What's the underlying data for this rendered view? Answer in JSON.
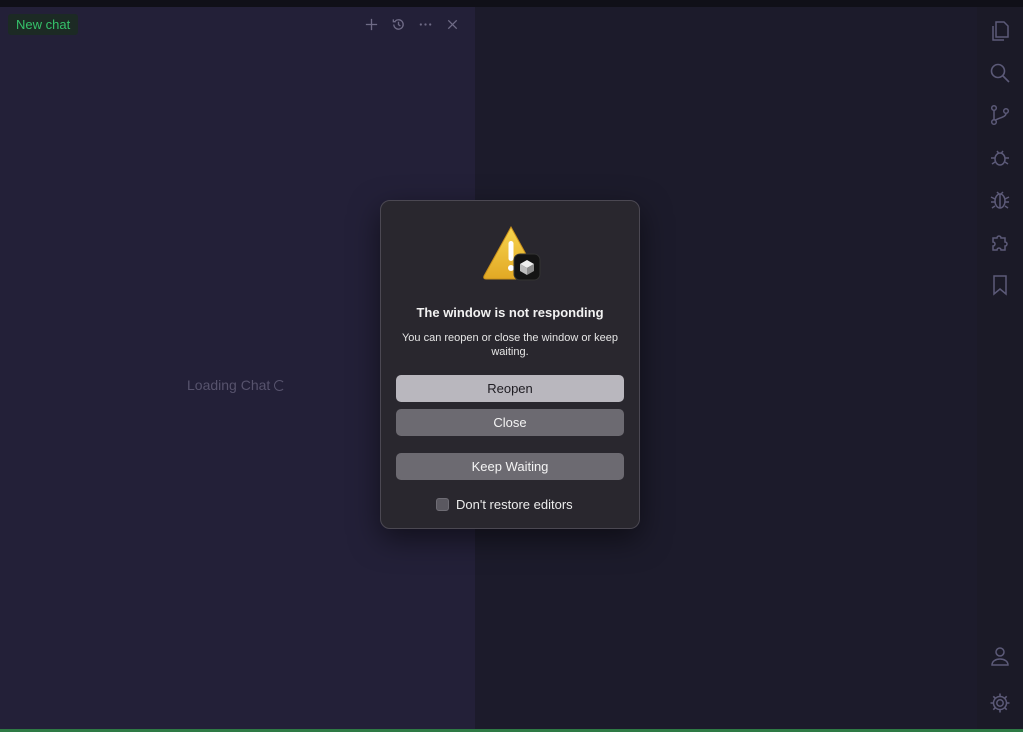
{
  "chat_panel": {
    "tab_label": "New chat",
    "loading_text": "Loading Chat",
    "tools": [
      {
        "icon": "plus-icon"
      },
      {
        "icon": "history-icon"
      },
      {
        "icon": "more-icon"
      },
      {
        "icon": "close-icon"
      }
    ]
  },
  "activity_bar": {
    "icons": [
      "files-icon",
      "search-icon",
      "source-control-icon",
      "debug-icon",
      "bug-icon",
      "extensions-icon",
      "bookmark-icon",
      "account-icon",
      "settings-icon"
    ]
  },
  "dialog": {
    "title": "The window is not responding",
    "message": "You can reopen or close the window or keep waiting.",
    "buttons": {
      "reopen": "Reopen",
      "close": "Close",
      "keep_waiting": "Keep Waiting"
    },
    "checkbox_label": "Don't restore editors",
    "checkbox_checked": false
  },
  "colors": {
    "accent_green": "#35c16a",
    "warning_yellow": "#f2c12e"
  }
}
